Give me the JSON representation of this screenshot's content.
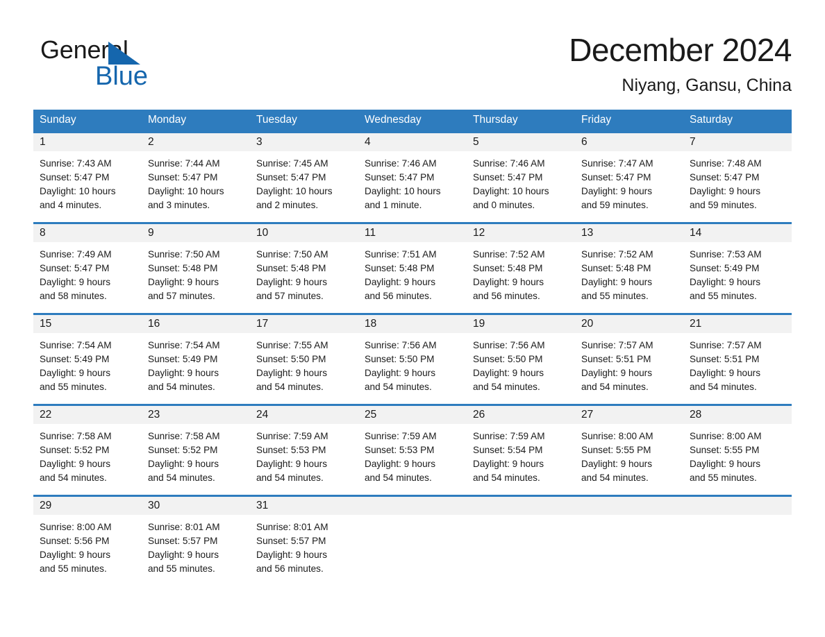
{
  "brand": {
    "name_top": "General",
    "name_bottom": "Blue",
    "accent_color": "#1566ad",
    "triangle_icon": "triangle-logo-icon"
  },
  "header": {
    "title": "December 2024",
    "location": "Niyang, Gansu, China"
  },
  "calendar": {
    "header_bg": "#2e7cbe",
    "daynum_bg": "#f2f2f2",
    "weekday_names": [
      "Sunday",
      "Monday",
      "Tuesday",
      "Wednesday",
      "Thursday",
      "Friday",
      "Saturday"
    ],
    "weeks": [
      [
        {
          "day": "1",
          "sunrise": "Sunrise: 7:43 AM",
          "sunset": "Sunset: 5:47 PM",
          "daylight_line1": "Daylight: 10 hours",
          "daylight_line2": "and 4 minutes."
        },
        {
          "day": "2",
          "sunrise": "Sunrise: 7:44 AM",
          "sunset": "Sunset: 5:47 PM",
          "daylight_line1": "Daylight: 10 hours",
          "daylight_line2": "and 3 minutes."
        },
        {
          "day": "3",
          "sunrise": "Sunrise: 7:45 AM",
          "sunset": "Sunset: 5:47 PM",
          "daylight_line1": "Daylight: 10 hours",
          "daylight_line2": "and 2 minutes."
        },
        {
          "day": "4",
          "sunrise": "Sunrise: 7:46 AM",
          "sunset": "Sunset: 5:47 PM",
          "daylight_line1": "Daylight: 10 hours",
          "daylight_line2": "and 1 minute."
        },
        {
          "day": "5",
          "sunrise": "Sunrise: 7:46 AM",
          "sunset": "Sunset: 5:47 PM",
          "daylight_line1": "Daylight: 10 hours",
          "daylight_line2": "and 0 minutes."
        },
        {
          "day": "6",
          "sunrise": "Sunrise: 7:47 AM",
          "sunset": "Sunset: 5:47 PM",
          "daylight_line1": "Daylight: 9 hours",
          "daylight_line2": "and 59 minutes."
        },
        {
          "day": "7",
          "sunrise": "Sunrise: 7:48 AM",
          "sunset": "Sunset: 5:47 PM",
          "daylight_line1": "Daylight: 9 hours",
          "daylight_line2": "and 59 minutes."
        }
      ],
      [
        {
          "day": "8",
          "sunrise": "Sunrise: 7:49 AM",
          "sunset": "Sunset: 5:47 PM",
          "daylight_line1": "Daylight: 9 hours",
          "daylight_line2": "and 58 minutes."
        },
        {
          "day": "9",
          "sunrise": "Sunrise: 7:50 AM",
          "sunset": "Sunset: 5:48 PM",
          "daylight_line1": "Daylight: 9 hours",
          "daylight_line2": "and 57 minutes."
        },
        {
          "day": "10",
          "sunrise": "Sunrise: 7:50 AM",
          "sunset": "Sunset: 5:48 PM",
          "daylight_line1": "Daylight: 9 hours",
          "daylight_line2": "and 57 minutes."
        },
        {
          "day": "11",
          "sunrise": "Sunrise: 7:51 AM",
          "sunset": "Sunset: 5:48 PM",
          "daylight_line1": "Daylight: 9 hours",
          "daylight_line2": "and 56 minutes."
        },
        {
          "day": "12",
          "sunrise": "Sunrise: 7:52 AM",
          "sunset": "Sunset: 5:48 PM",
          "daylight_line1": "Daylight: 9 hours",
          "daylight_line2": "and 56 minutes."
        },
        {
          "day": "13",
          "sunrise": "Sunrise: 7:52 AM",
          "sunset": "Sunset: 5:48 PM",
          "daylight_line1": "Daylight: 9 hours",
          "daylight_line2": "and 55 minutes."
        },
        {
          "day": "14",
          "sunrise": "Sunrise: 7:53 AM",
          "sunset": "Sunset: 5:49 PM",
          "daylight_line1": "Daylight: 9 hours",
          "daylight_line2": "and 55 minutes."
        }
      ],
      [
        {
          "day": "15",
          "sunrise": "Sunrise: 7:54 AM",
          "sunset": "Sunset: 5:49 PM",
          "daylight_line1": "Daylight: 9 hours",
          "daylight_line2": "and 55 minutes."
        },
        {
          "day": "16",
          "sunrise": "Sunrise: 7:54 AM",
          "sunset": "Sunset: 5:49 PM",
          "daylight_line1": "Daylight: 9 hours",
          "daylight_line2": "and 54 minutes."
        },
        {
          "day": "17",
          "sunrise": "Sunrise: 7:55 AM",
          "sunset": "Sunset: 5:50 PM",
          "daylight_line1": "Daylight: 9 hours",
          "daylight_line2": "and 54 minutes."
        },
        {
          "day": "18",
          "sunrise": "Sunrise: 7:56 AM",
          "sunset": "Sunset: 5:50 PM",
          "daylight_line1": "Daylight: 9 hours",
          "daylight_line2": "and 54 minutes."
        },
        {
          "day": "19",
          "sunrise": "Sunrise: 7:56 AM",
          "sunset": "Sunset: 5:50 PM",
          "daylight_line1": "Daylight: 9 hours",
          "daylight_line2": "and 54 minutes."
        },
        {
          "day": "20",
          "sunrise": "Sunrise: 7:57 AM",
          "sunset": "Sunset: 5:51 PM",
          "daylight_line1": "Daylight: 9 hours",
          "daylight_line2": "and 54 minutes."
        },
        {
          "day": "21",
          "sunrise": "Sunrise: 7:57 AM",
          "sunset": "Sunset: 5:51 PM",
          "daylight_line1": "Daylight: 9 hours",
          "daylight_line2": "and 54 minutes."
        }
      ],
      [
        {
          "day": "22",
          "sunrise": "Sunrise: 7:58 AM",
          "sunset": "Sunset: 5:52 PM",
          "daylight_line1": "Daylight: 9 hours",
          "daylight_line2": "and 54 minutes."
        },
        {
          "day": "23",
          "sunrise": "Sunrise: 7:58 AM",
          "sunset": "Sunset: 5:52 PM",
          "daylight_line1": "Daylight: 9 hours",
          "daylight_line2": "and 54 minutes."
        },
        {
          "day": "24",
          "sunrise": "Sunrise: 7:59 AM",
          "sunset": "Sunset: 5:53 PM",
          "daylight_line1": "Daylight: 9 hours",
          "daylight_line2": "and 54 minutes."
        },
        {
          "day": "25",
          "sunrise": "Sunrise: 7:59 AM",
          "sunset": "Sunset: 5:53 PM",
          "daylight_line1": "Daylight: 9 hours",
          "daylight_line2": "and 54 minutes."
        },
        {
          "day": "26",
          "sunrise": "Sunrise: 7:59 AM",
          "sunset": "Sunset: 5:54 PM",
          "daylight_line1": "Daylight: 9 hours",
          "daylight_line2": "and 54 minutes."
        },
        {
          "day": "27",
          "sunrise": "Sunrise: 8:00 AM",
          "sunset": "Sunset: 5:55 PM",
          "daylight_line1": "Daylight: 9 hours",
          "daylight_line2": "and 54 minutes."
        },
        {
          "day": "28",
          "sunrise": "Sunrise: 8:00 AM",
          "sunset": "Sunset: 5:55 PM",
          "daylight_line1": "Daylight: 9 hours",
          "daylight_line2": "and 55 minutes."
        }
      ],
      [
        {
          "day": "29",
          "sunrise": "Sunrise: 8:00 AM",
          "sunset": "Sunset: 5:56 PM",
          "daylight_line1": "Daylight: 9 hours",
          "daylight_line2": "and 55 minutes."
        },
        {
          "day": "30",
          "sunrise": "Sunrise: 8:01 AM",
          "sunset": "Sunset: 5:57 PM",
          "daylight_line1": "Daylight: 9 hours",
          "daylight_line2": "and 55 minutes."
        },
        {
          "day": "31",
          "sunrise": "Sunrise: 8:01 AM",
          "sunset": "Sunset: 5:57 PM",
          "daylight_line1": "Daylight: 9 hours",
          "daylight_line2": "and 56 minutes."
        },
        {
          "day": "",
          "sunrise": "",
          "sunset": "",
          "daylight_line1": "",
          "daylight_line2": ""
        },
        {
          "day": "",
          "sunrise": "",
          "sunset": "",
          "daylight_line1": "",
          "daylight_line2": ""
        },
        {
          "day": "",
          "sunrise": "",
          "sunset": "",
          "daylight_line1": "",
          "daylight_line2": ""
        },
        {
          "day": "",
          "sunrise": "",
          "sunset": "",
          "daylight_line1": "",
          "daylight_line2": ""
        }
      ]
    ]
  }
}
